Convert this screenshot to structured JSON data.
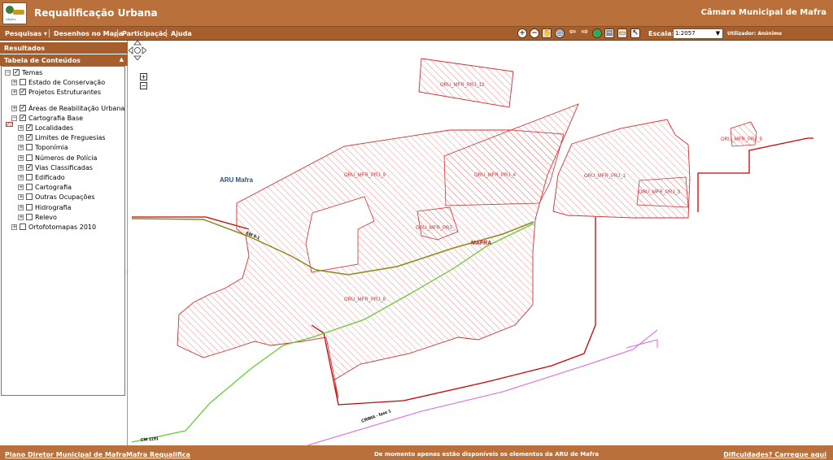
{
  "header": {
    "app_title": "Requalificação Urbana",
    "org_title": "Câmara Municipal de Mafra",
    "logo_text": "Mafra"
  },
  "menu": {
    "items": [
      {
        "label": "Pesquisas ▾"
      },
      {
        "label": "Desenhos no Mapa"
      },
      {
        "label": "Participação"
      },
      {
        "label": "Ajuda"
      }
    ],
    "tools": [
      {
        "icon": "zoom-in-icon",
        "glyph": "+"
      },
      {
        "icon": "zoom-out-icon",
        "glyph": "−"
      },
      {
        "icon": "pan-hand-icon",
        "glyph": "✋"
      },
      {
        "icon": "zoom-extent-icon",
        "glyph": "◎"
      },
      {
        "icon": "back-arrow-icon",
        "glyph": "⇦"
      },
      {
        "icon": "forward-arrow-icon",
        "glyph": "⇨"
      },
      {
        "icon": "globe-icon",
        "glyph": "●"
      },
      {
        "icon": "print-icon",
        "glyph": "▤"
      },
      {
        "icon": "measure-icon",
        "glyph": "▭"
      },
      {
        "icon": "select-icon",
        "glyph": "↖"
      }
    ],
    "scale_label": "Escala:",
    "scale_value": "1:2057",
    "user_label": "Utilizador: Anónimo"
  },
  "left_panel": {
    "results_title": "Resultados",
    "toc_title": "Tabela de Conteúdos",
    "tree": [
      {
        "label": "Temas",
        "checked": true,
        "level": 0
      },
      {
        "label": "Estado de Conservação",
        "checked": false,
        "level": 1
      },
      {
        "label": "Projetos Estruturantes",
        "checked": true,
        "level": 1
      },
      {
        "label": "Áreas de Reabilitação Urbana",
        "checked": true,
        "level": 1
      },
      {
        "label": "Cartografia Base",
        "checked": true,
        "level": 1
      },
      {
        "label": "Localidades",
        "checked": true,
        "level": 2
      },
      {
        "label": "Limites de Freguesias",
        "checked": true,
        "level": 2
      },
      {
        "label": "Toponímia",
        "checked": false,
        "level": 2
      },
      {
        "label": "Números de Polícia",
        "checked": false,
        "level": 2
      },
      {
        "label": "Vias Classificadas",
        "checked": true,
        "level": 2
      },
      {
        "label": "Edificado",
        "checked": false,
        "level": 2
      },
      {
        "label": "Cartografia",
        "checked": false,
        "level": 2
      },
      {
        "label": "Outras Ocupações",
        "checked": false,
        "level": 2
      },
      {
        "label": "Hidrografia",
        "checked": false,
        "level": 2
      },
      {
        "label": "Relevo",
        "checked": false,
        "level": 2
      },
      {
        "label": "Ortofotomapas 2010",
        "checked": false,
        "level": 1
      }
    ]
  },
  "map": {
    "aru_label": "ARU Mafra",
    "town_label": "MAFRA",
    "project_labels": [
      "ORU_MFR_PRJ_12",
      "ORU_MFR_PRJ_9",
      "ORU_MFR_PRJ_4",
      "ORU_MFR_PRJ_1",
      "ORU_MFR_PRJ_5",
      "ORU_MFR_PRJ_3",
      "ORU_MFR_PRJ_",
      "ORU_MFR_PRJ_8"
    ],
    "road_labels": [
      "EM 9-1",
      "CM 1191",
      "CRIMA - fase 1"
    ],
    "colors": {
      "project": "#d32f2f",
      "aru_boundary": "#cc0000",
      "road_green": "#66cc33",
      "road_olive": "#8a8a1a",
      "road_pink": "#e066e0"
    }
  },
  "footer": {
    "link1": "Plano Diretor Municipal de Mafra",
    "link2": "Mafra Requalifica",
    "message": "De momento apenas estão disponíveis os elementos da ARU de Mafra",
    "link3": "Dificuldades? Carregue aqui"
  }
}
